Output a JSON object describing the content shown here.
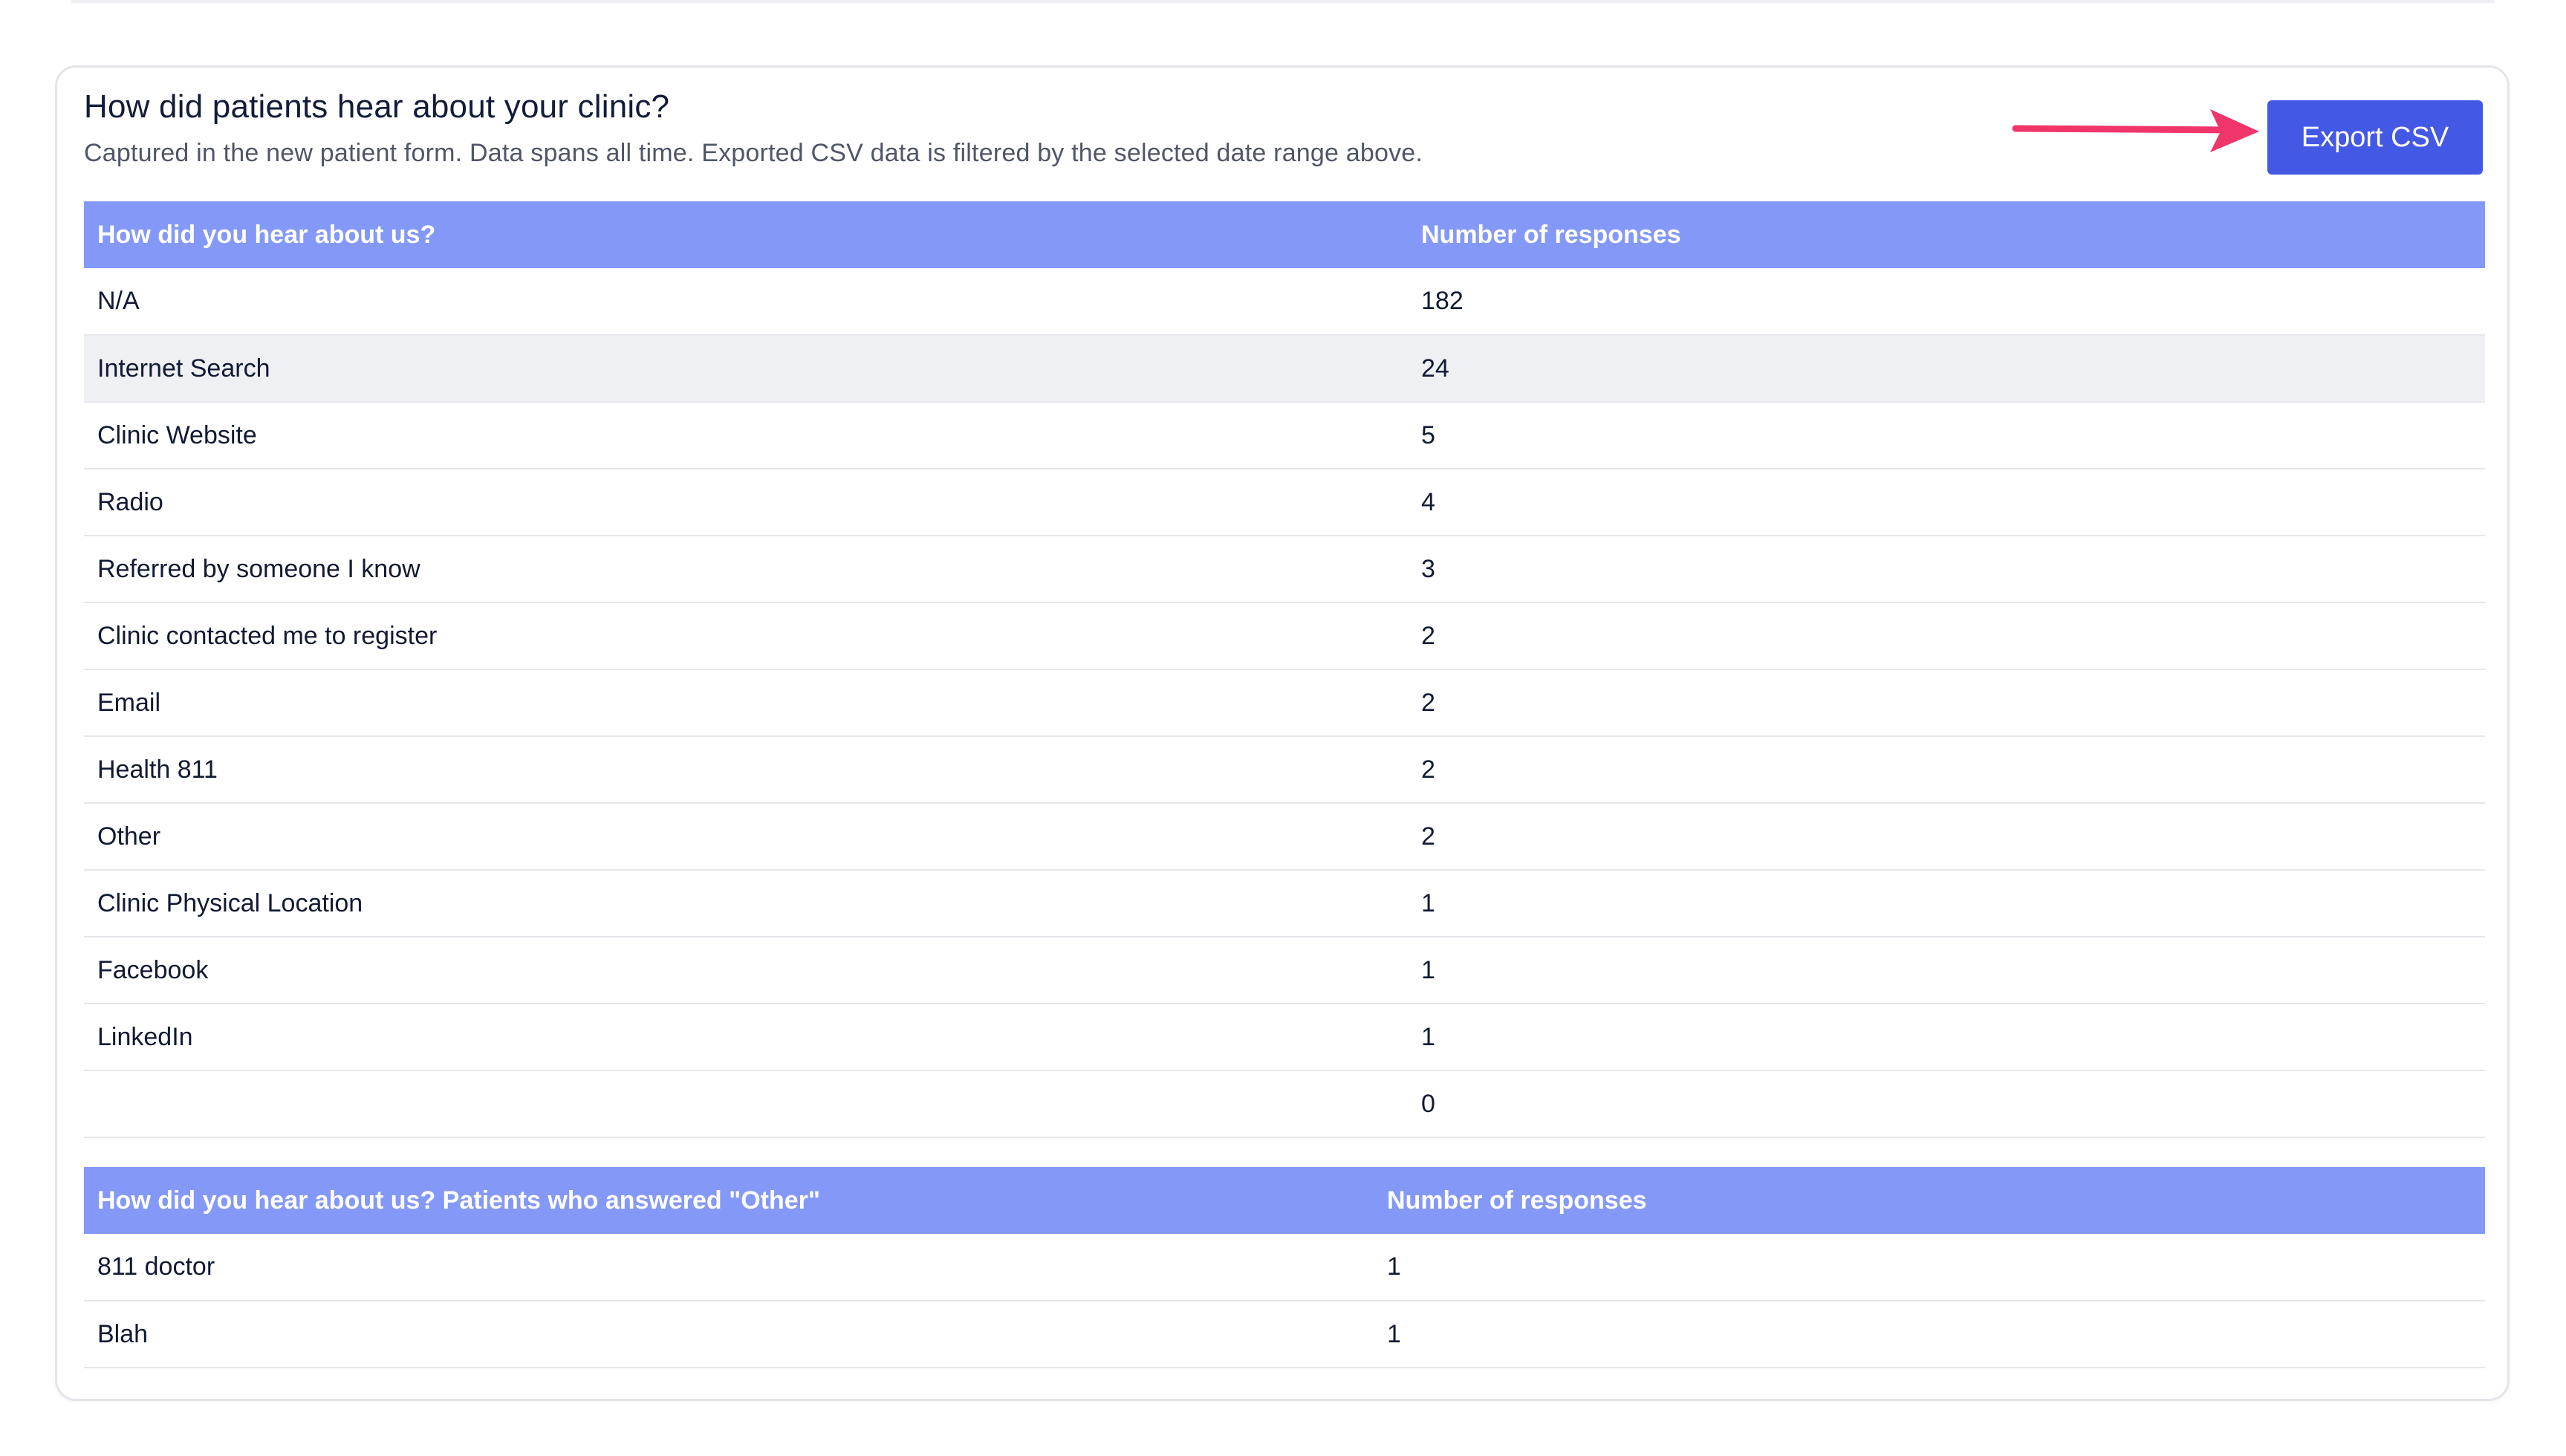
{
  "card": {
    "title": "How did patients hear about your clinic?",
    "subtitle": "Captured in the new patient form. Data spans all time. Exported CSV data is filtered by the selected date range above.",
    "export_label": "Export CSV"
  },
  "arrow": {
    "icon": "arrow-right-icon",
    "color": "#f0356b"
  },
  "colors": {
    "header_bg": "#8499f7",
    "button_bg": "#4458e6",
    "alt_row_bg": "#eef0f4"
  },
  "main_table": {
    "headers": [
      "How did you hear about us?",
      "Number of responses"
    ],
    "rows": [
      {
        "source": "N/A",
        "count": "182"
      },
      {
        "source": "Internet Search",
        "count": "24"
      },
      {
        "source": "Clinic Website",
        "count": "5"
      },
      {
        "source": "Radio",
        "count": "4"
      },
      {
        "source": "Referred by someone I know",
        "count": "3"
      },
      {
        "source": "Clinic contacted me to register",
        "count": "2"
      },
      {
        "source": "Email",
        "count": "2"
      },
      {
        "source": "Health 811",
        "count": "2"
      },
      {
        "source": "Other",
        "count": "2"
      },
      {
        "source": "Clinic Physical Location",
        "count": "1"
      },
      {
        "source": "Facebook",
        "count": "1"
      },
      {
        "source": "LinkedIn",
        "count": "1"
      },
      {
        "source": "",
        "count": "0"
      }
    ]
  },
  "other_table": {
    "headers": [
      "How did you hear about us? Patients who answered \"Other\"",
      "Number of responses"
    ],
    "rows": [
      {
        "source": "811 doctor",
        "count": "1"
      },
      {
        "source": "Blah",
        "count": "1"
      }
    ]
  }
}
